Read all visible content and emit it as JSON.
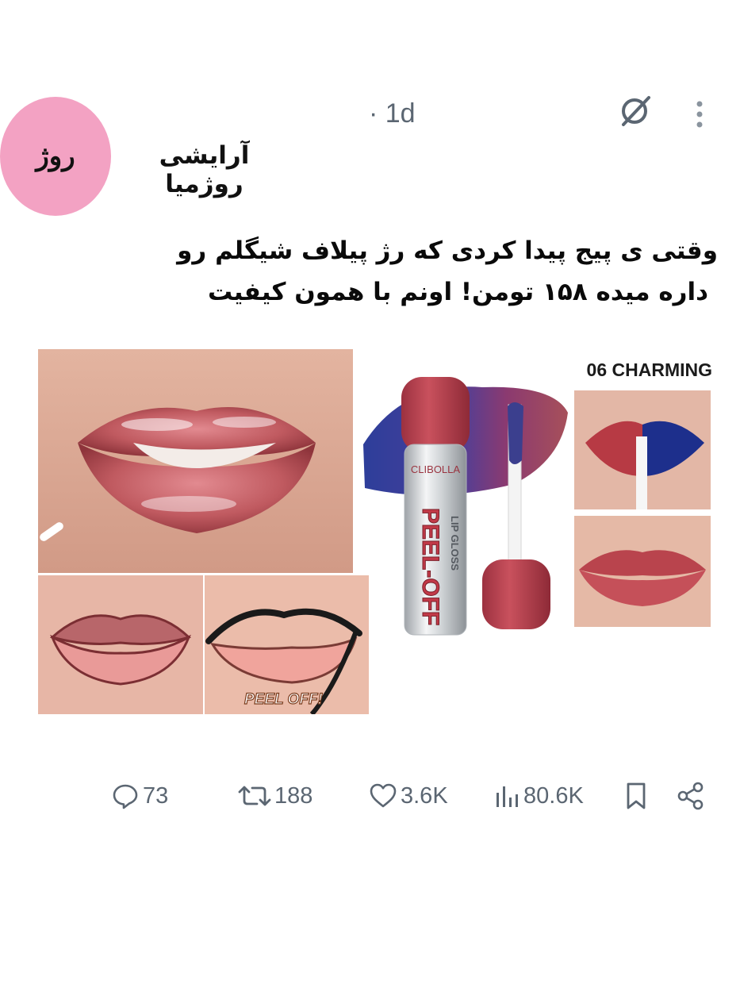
{
  "author": {
    "avatar_text": "روژ",
    "display_name": "آرایشی روژمیا"
  },
  "meta": {
    "timestamp": "· 1d",
    "grok_icon": "slashed-circle-icon",
    "more_icon": "vertical-dots-icon"
  },
  "post": {
    "lines": [
      "وقتی ی پیج پیدا کردی که رژ پیلاف شیگلم رو",
      "داره میده ۱۵۸ تومن! اونم با همون کیفیت"
    ]
  },
  "media": {
    "shade_label": "06 CHARMING",
    "product_brand": "CLIBOLLA",
    "product_name": "PEEL-OFF",
    "product_type": "LIP GLOSS",
    "peel_badge": "PEEL OFF!",
    "colors": {
      "lip": "#c05a60",
      "cap": "#b8434f",
      "blue_swatch": "#2d3e9a",
      "skin": "#d9a893",
      "badge_text": "#ffffff",
      "badge_stroke": "#7a3b1c"
    }
  },
  "actions": {
    "replies": "73",
    "reposts": "188",
    "likes": "3.6K",
    "views": "80.6K",
    "reply_icon": "speech-bubble-icon",
    "repost_icon": "repost-arrows-icon",
    "like_icon": "heart-icon",
    "views_icon": "bar-chart-icon",
    "bookmark_icon": "bookmark-icon",
    "share_icon": "share-nodes-icon"
  }
}
